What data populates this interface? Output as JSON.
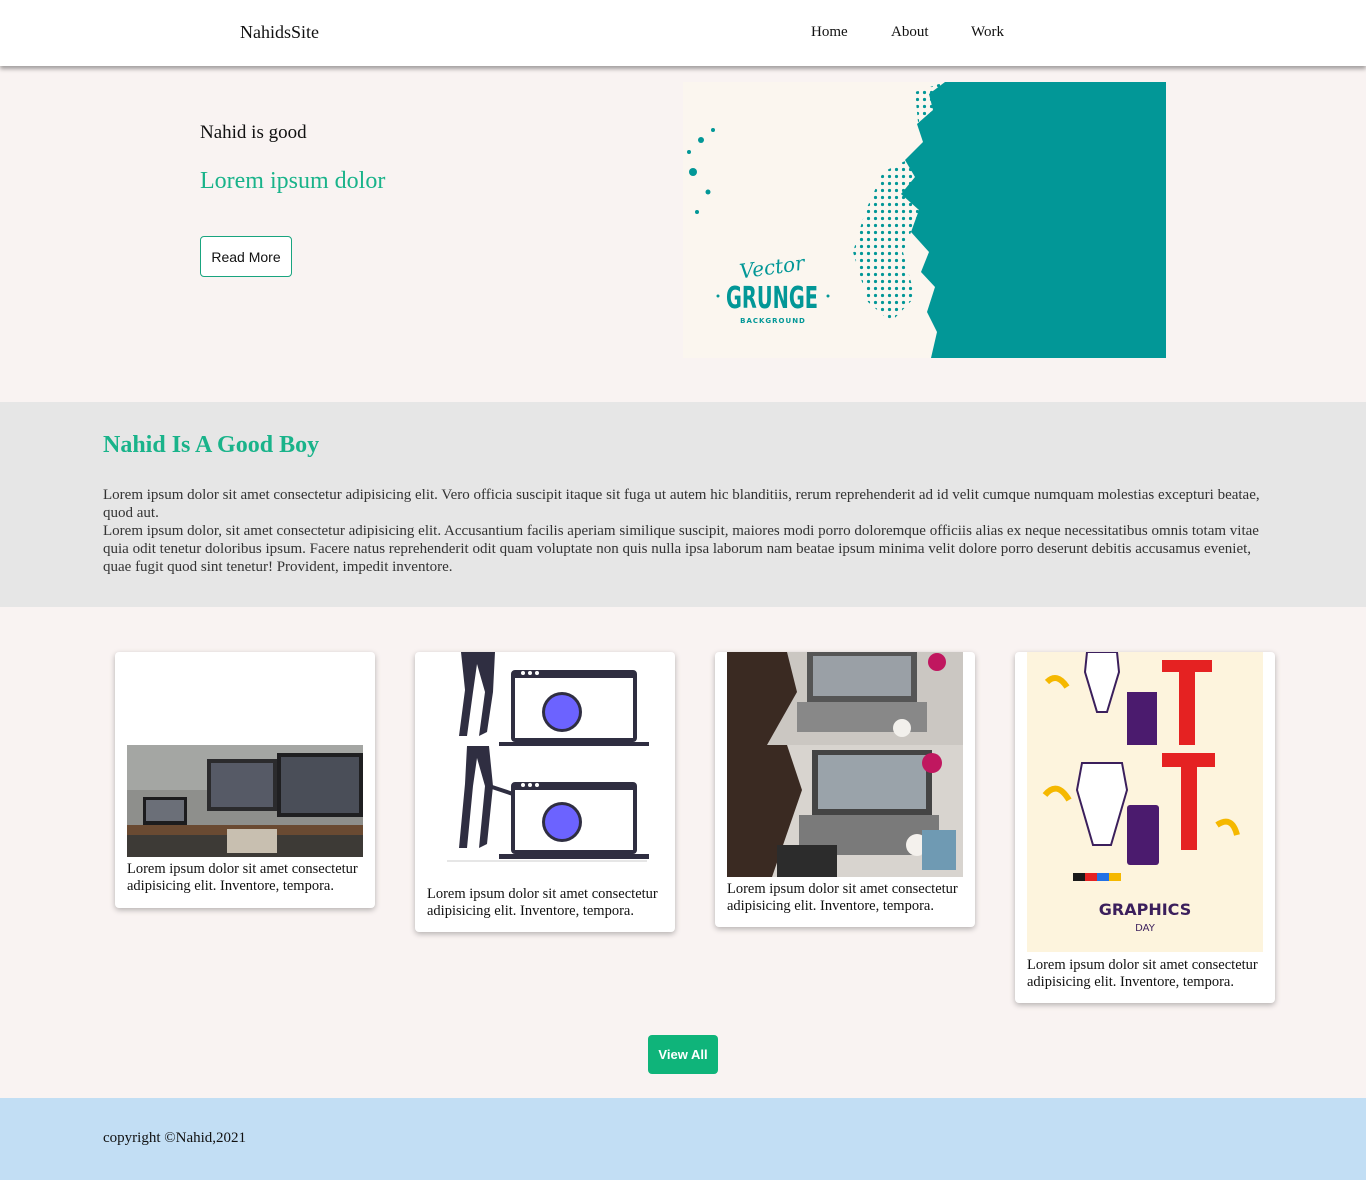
{
  "header": {
    "brand": "NahidsSite",
    "nav": [
      "Home",
      "About",
      "Work"
    ]
  },
  "hero": {
    "eyebrow": "Nahid is good",
    "title": "Lorem ipsum dolor",
    "button_label": "Read More",
    "image": {
      "script_text": "Vector",
      "main_text": "GRUNGE",
      "sub_text": "BACKGROUND"
    }
  },
  "about": {
    "title": "Nahid Is A Good Boy",
    "paragraph_1": "Lorem ipsum dolor sit amet consectetur adipisicing elit. Vero officia suscipit itaque sit fuga ut autem hic blanditiis, rerum reprehenderit ad id velit cumque numquam molestias excepturi beatae, quod aut.",
    "paragraph_2": "Lorem ipsum dolor, sit amet consectetur adipisicing elit. Accusantium facilis aperiam similique suscipit, maiores modi porro doloremque officiis alias ex neque necessitatibus omnis totam vitae quia odit tenetur doloribus ipsum. Facere natus reprehenderit odit quam voluptate non quis nulla ipsa laborum nam beatae ipsum minima velit dolore porro deserunt debitis accusamus eveniet, quae fugit quod sint tenetur! Provident, impedit inventore."
  },
  "cards": [
    {
      "text": "Lorem ipsum dolor sit amet consectetur adipisicing elit. Inventore, tempora.",
      "image": "desk-computer-photo"
    },
    {
      "text": "Lorem ipsum dolor sit amet consectetur adipisicing elit. Inventore, tempora.",
      "image": "person-laptop-illustration"
    },
    {
      "text": "Lorem ipsum dolor sit amet consectetur adipisicing elit. Inventore, tempora.",
      "image": "woman-laptop-photo"
    },
    {
      "text": "Lorem ipsum dolor sit amet consectetur adipisicing elit. Inventore, tempora.",
      "image": "graphics-day-illustration",
      "art_title": "GRAPHICS",
      "art_subtitle": "DAY"
    }
  ],
  "view_all_label": "View All",
  "footer": {
    "copyright": "copyright ©Nahid,2021"
  },
  "colors": {
    "accent": "#19b38a",
    "button": "#0fb47a",
    "teal": "#029797",
    "page_bg": "#f9f3f2",
    "band_bg": "#e6e6e6",
    "footer_bg": "#c2def4"
  }
}
